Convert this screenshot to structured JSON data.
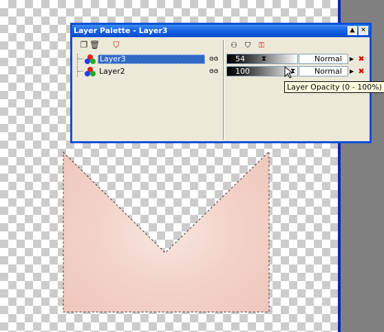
{
  "palette": {
    "title": "Layer Palette - Layer3",
    "minimize_icon": "minimize-icon",
    "close_icon": "close-icon",
    "tools": [
      "new-layer-icon",
      "delete-layer-icon",
      "mask-icon"
    ],
    "tabs": [
      "layer-visibility-tab-icon",
      "mask-tab-icon",
      "link-tab-icon"
    ],
    "layers": [
      {
        "name": "Layer3",
        "selected": true,
        "opacity": "54",
        "blend_mode": "Normal"
      },
      {
        "name": "Layer2",
        "selected": false,
        "opacity": "100",
        "blend_mode": "Normal"
      }
    ]
  },
  "tooltip": {
    "text": "Layer Opacity (0 - 100%)"
  },
  "colors": {
    "title_bar": "#0a4cd0",
    "selection": "#316ac5",
    "shape_fill": "#f6d6cc"
  }
}
